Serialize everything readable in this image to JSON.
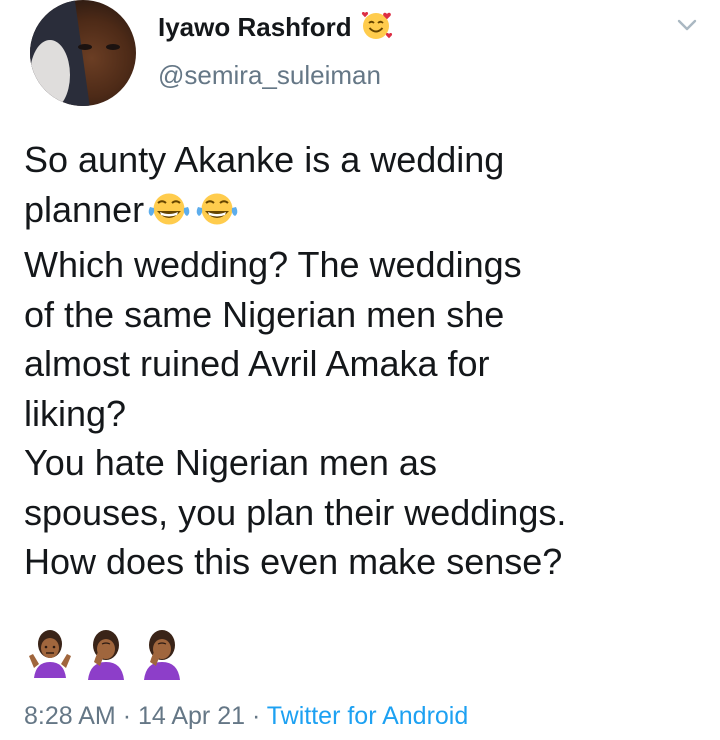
{
  "tweet": {
    "display_name": "Iyawo Rashford",
    "name_emoji": "smiling-face-with-hearts-icon",
    "handle": "@semira_suleiman",
    "text_lines": [
      "So aunty Akanke is a wedding",
      "planner",
      "Which wedding? The weddings",
      "of the same Nigerian men she",
      "almost ruined Avril Amaka for",
      "liking?",
      "You hate Nigerian men as",
      "spouses, you plan their weddings.",
      "How does this even make sense?"
    ],
    "inline_emojis": [
      "face-with-tears-of-joy-icon",
      "face-with-tears-of-joy-icon"
    ],
    "gesture_emojis": [
      "person-shrugging-icon",
      "person-facepalming-icon",
      "person-facepalming-icon"
    ],
    "time": "8:28 AM",
    "separator": "·",
    "date": "14 Apr 21",
    "source": "Twitter for Android"
  },
  "colors": {
    "text": "#14171a",
    "secondary": "#657786",
    "link": "#1da1f2",
    "emoji_yellow": "#ffcc4d",
    "emoji_purple": "#8d3ec9"
  }
}
